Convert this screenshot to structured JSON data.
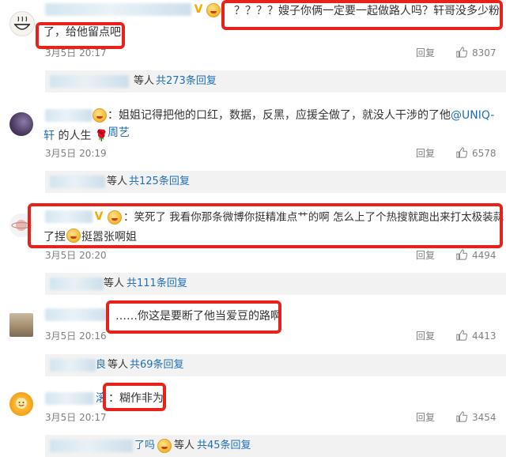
{
  "comments": [
    {
      "text": "？？？？嫂子你俩一定要一起做路人吗？轩哥没多少粉",
      "text_cont": "了，给他留点吧",
      "time": "3月5日 20:17",
      "reply_label": "回复",
      "likes": "8307",
      "sub_summary": "等人",
      "sub_count": "共273条回复",
      "avatar_icon": "rice-bowl-avatar"
    },
    {
      "text_pre": "：姐姐记得把他的口红，数据，反黑，应援全做了，就没人干涉的了他",
      "mention": "@UNIQ-周艺",
      "mention_cont": "轩",
      "text_post": " 的人生",
      "rose": "🌹",
      "time": "3月5日 20:19",
      "reply_label": "回复",
      "likes": "6578",
      "sub_summary": "等人",
      "sub_count": "共125条回复",
      "avatar_icon": "purple-moon-avatar"
    },
    {
      "text": "：笑死了 我看你那条微博你挺精准点艹的啊 怎么上了个热搜就跑出来打太极装蒜",
      "text_cont_pre": "了捏",
      "text_cont_post": "挺嚣张啊姐",
      "time": "3月5日 20:20",
      "reply_label": "回复",
      "likes": "4494",
      "sub_summary": "等人",
      "sub_count": "共111条回复",
      "avatar_icon": "planet-avatar"
    },
    {
      "text": "……你这是要断了他当爱豆的路啊",
      "time": "3月5日 20:16",
      "reply_label": "回复",
      "likes": "4413",
      "sub_summary_pre": "良",
      "sub_summary": "等人",
      "sub_count": "共69条回复",
      "avatar_icon": "bookshelf-avatar"
    },
    {
      "name_tail": "滚",
      "text": "：糊作非为",
      "time": "3月5日 20:17",
      "reply_label": "回复",
      "likes": "3454",
      "sub_summary_pre": "了吗",
      "sub_summary": "等人",
      "sub_count": "共45条回复",
      "avatar_icon": "sun-flower-avatar"
    }
  ],
  "colors": {
    "link": "#1e6fb7",
    "highlight_border": "#e8221a",
    "meta_text": "#808080",
    "sub_bg": "#f2f2f2"
  }
}
